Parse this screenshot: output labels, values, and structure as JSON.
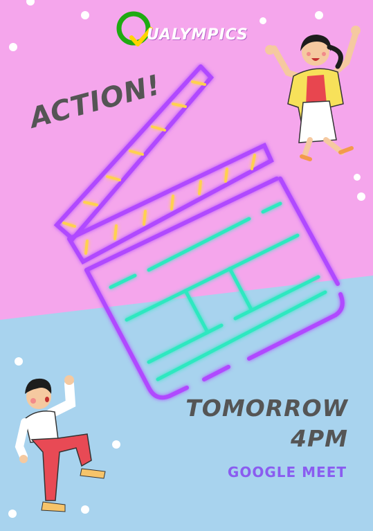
{
  "colors": {
    "pink": "#f5a6ec",
    "blue": "#a8d3ee",
    "neon_purple": "#b048ff",
    "neon_teal": "#2ee8c0",
    "neon_yellow": "#ffd150",
    "headline_gray": "#555555",
    "venue_purple": "#8a5cf0"
  },
  "logo": {
    "text": "UALYMPICS",
    "icon": "green-ring-check-q-icon"
  },
  "headline": {
    "text": "ACTION!"
  },
  "event": {
    "line1": "TOMORROW",
    "line2": "4PM",
    "venue": "GOOGLE MEET"
  },
  "illustrations": {
    "clapperboard": "neon-clapperboard-icon",
    "girl": "jumping-girl-illustration",
    "boy": "dancing-boy-illustration",
    "dots": "snow-dots-decoration"
  }
}
